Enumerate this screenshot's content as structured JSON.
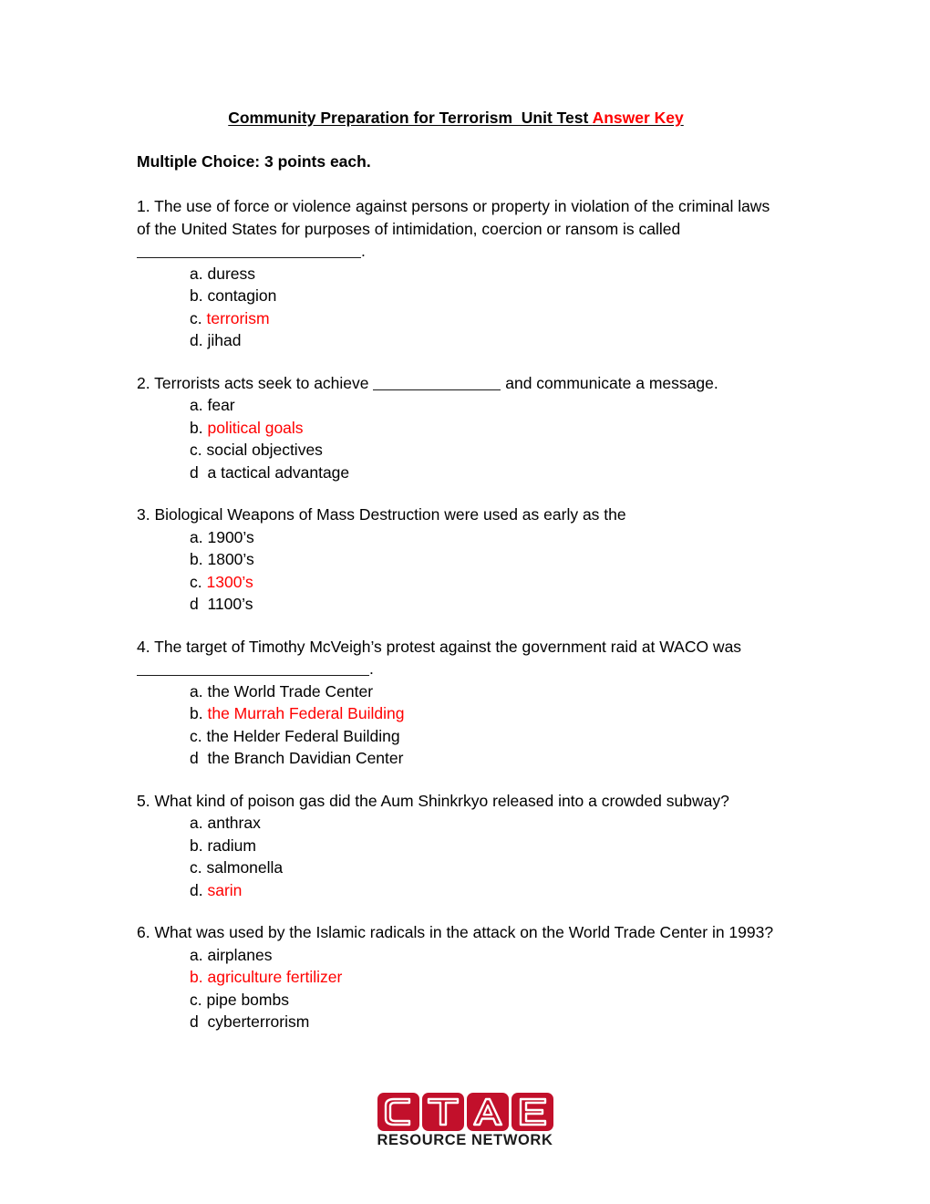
{
  "document": {
    "title_black": "Community Preparation for Terrorism  Unit Test ",
    "title_red": "Answer Key",
    "section_heading": "Multiple Choice: 3 points each."
  },
  "questions": [
    {
      "number": "1.",
      "text": "1.  The use of force or violence against persons or property in violation of the criminal laws of the United States for purposes of intimidation, coercion or ransom is called",
      "blank_after": true,
      "blank_style": "long",
      "blank_tail": ".",
      "options": [
        {
          "label": "a.",
          "text": "duress",
          "correct": false
        },
        {
          "label": "b.",
          "text": "contagion",
          "correct": false
        },
        {
          "label": "c.",
          "text": "terrorism",
          "correct": true
        },
        {
          "label": "d.",
          "text": "jihad",
          "correct": false
        }
      ]
    },
    {
      "number": "2.",
      "text_before": "2.  Terrorists acts seek to achieve ",
      "text_after": " and communicate a message.",
      "inline_blank": true,
      "options": [
        {
          "label": "a.",
          "text": "fear",
          "correct": false
        },
        {
          "label": "b.",
          "text": "political goals",
          "correct": true
        },
        {
          "label": "c.",
          "text": "social objectives",
          "correct": false
        },
        {
          "label": "d ",
          "text": "a tactical advantage",
          "correct": false
        }
      ]
    },
    {
      "number": "3.",
      "text": "3.  Biological Weapons of Mass Destruction were used as early as the",
      "options": [
        {
          "label": "a.",
          "text": "1900’s",
          "correct": false
        },
        {
          "label": "b.",
          "text": "1800’s",
          "correct": false
        },
        {
          "label": "c.",
          "text": "1300’s",
          "correct": true
        },
        {
          "label": "d ",
          "text": "1100’s",
          "correct": false
        }
      ]
    },
    {
      "number": "4.",
      "text": "4.  The target of Timothy McVeigh’s protest against the government raid at WACO was",
      "blank_after": true,
      "blank_style": "med",
      "blank_tail": ".",
      "options": [
        {
          "label": "a.",
          "text": "the World Trade Center",
          "correct": false
        },
        {
          "label": "b.",
          "text": "the Murrah Federal Building",
          "correct": true
        },
        {
          "label": "c.",
          "text": "the Helder Federal Building",
          "correct": false
        },
        {
          "label": "d ",
          "text": "the Branch Davidian Center",
          "correct": false
        }
      ]
    },
    {
      "number": "5.",
      "text": "5.  What kind of poison gas did the Aum Shinkrkyo released into a crowded subway?",
      "options": [
        {
          "label": "a.",
          "text": "anthrax",
          "correct": false
        },
        {
          "label": "b.",
          "text": "radium",
          "correct": false
        },
        {
          "label": "c.",
          "text": "salmonella",
          "correct": false
        },
        {
          "label": "d.",
          "text": "sarin",
          "correct": true
        }
      ]
    },
    {
      "number": "6.",
      "text": "6.  What was used by the Islamic radicals in the attack on the World Trade Center in 1993?",
      "options": [
        {
          "label": "a.",
          "text": "airplanes",
          "correct": false
        },
        {
          "label": "b.",
          "text": "agriculture fertilizer",
          "correct": true,
          "label_red": true
        },
        {
          "label": "c.",
          "text": "pipe bombs",
          "correct": false
        },
        {
          "label": "d ",
          "text": "cyberterrorism",
          "correct": false
        }
      ]
    }
  ],
  "logo": {
    "letters": [
      "C",
      "T",
      "A",
      "E"
    ],
    "subtitle": "RESOURCE NETWORK",
    "tile_color": "#c2102b",
    "letter_color": "#ffffff"
  },
  "colors": {
    "answer_red": "#ff0000",
    "text_black": "#000000",
    "logo_red": "#c2102b"
  }
}
